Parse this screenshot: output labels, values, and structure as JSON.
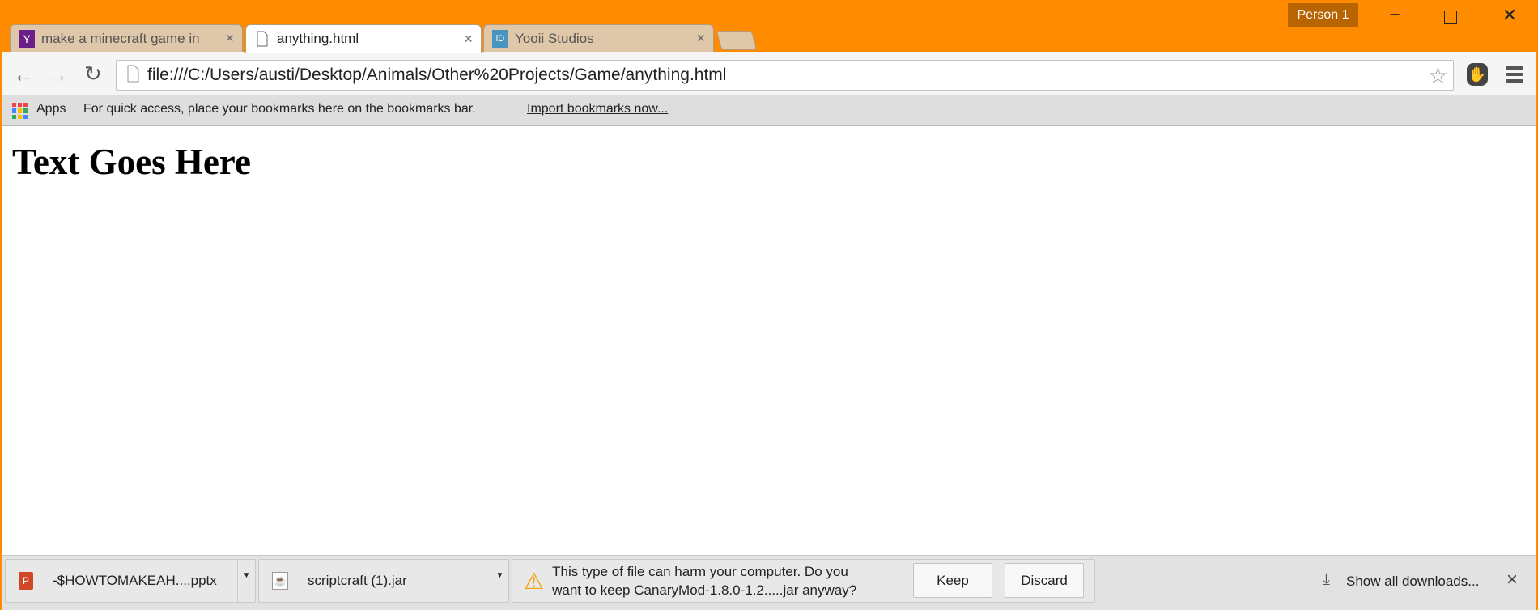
{
  "window": {
    "profile": "Person 1",
    "minimize": "–",
    "maximize": "☐",
    "close": "✕"
  },
  "tabs": [
    {
      "label": "make a minecraft game in",
      "close": "×",
      "icon": "yahoo-icon",
      "favicon_text": "Y"
    },
    {
      "label": "anything.html",
      "close": "×",
      "icon": "file-icon"
    },
    {
      "label": "Yooii Studios",
      "close": "×",
      "icon": "yooii-icon",
      "favicon_text": "iD"
    }
  ],
  "toolbar": {
    "url": "file:///C:/Users/austi/Desktop/Animals/Other%20Projects/Game/anything.html"
  },
  "bookmarks": {
    "apps": "Apps",
    "hint": "For quick access, place your bookmarks here on the bookmarks bar.",
    "import": "Import bookmarks now..."
  },
  "page": {
    "heading": "Text Goes Here"
  },
  "downloads": {
    "items": [
      {
        "name": "-$HOWTOMAKEAH....pptx",
        "icon": "powerpoint-icon"
      },
      {
        "name": "scriptcraft (1).jar",
        "icon": "java-icon"
      }
    ],
    "warning_line1": "This type of file can harm your computer. Do you",
    "warning_line2": "want to keep CanaryMod-1.8.0-1.2.....jar anyway?",
    "keep": "Keep",
    "discard": "Discard",
    "show_all": "Show all downloads...",
    "close": "×"
  }
}
